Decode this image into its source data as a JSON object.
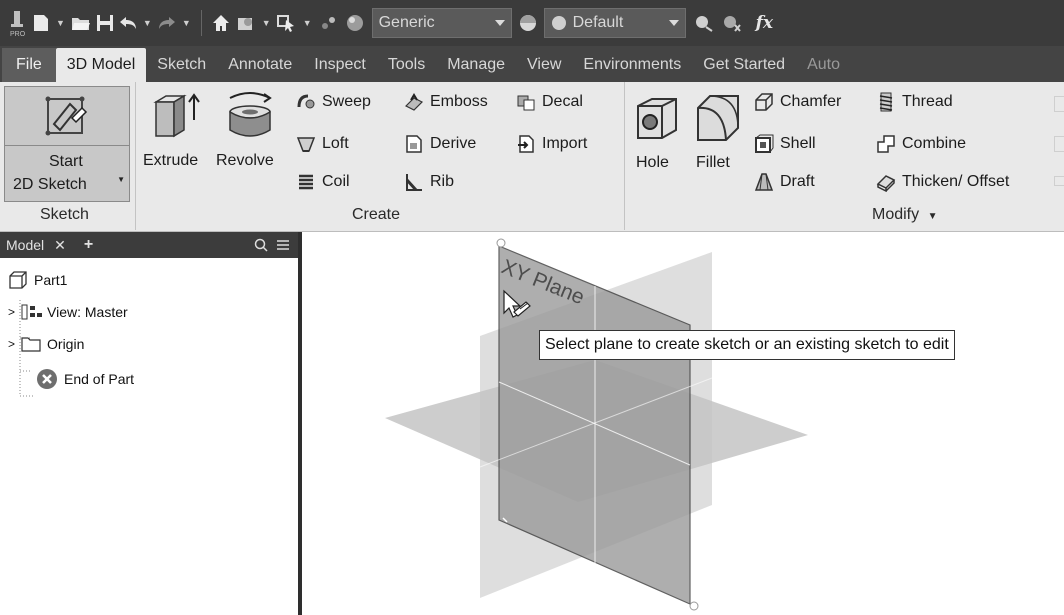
{
  "qat": {
    "material": "Generic",
    "appearance": "Default",
    "function_symbol": "fx",
    "icons": [
      "inventor-pro-logo",
      "new-icon",
      "open-icon",
      "save-icon",
      "undo-icon",
      "redo-icon",
      "home-icon",
      "update-icon",
      "select-icon",
      "color-icon",
      "material-ball-icon",
      "appearance-ball-icon",
      "clear-override-icon",
      "adjust-icon",
      "parameters-icon"
    ]
  },
  "tabs": [
    {
      "label": "File"
    },
    {
      "label": "3D Model",
      "active": true
    },
    {
      "label": "Sketch"
    },
    {
      "label": "Annotate"
    },
    {
      "label": "Inspect"
    },
    {
      "label": "Tools"
    },
    {
      "label": "Manage"
    },
    {
      "label": "View"
    },
    {
      "label": "Environments"
    },
    {
      "label": "Get Started"
    },
    {
      "label": "Auto"
    }
  ],
  "ribbon": {
    "sketch_group": {
      "start_line1": "Start",
      "start_line2": "2D Sketch",
      "label": "Sketch"
    },
    "create_group": {
      "extrude": "Extrude",
      "revolve": "Revolve",
      "sweep": "Sweep",
      "loft": "Loft",
      "coil": "Coil",
      "emboss": "Emboss",
      "derive": "Derive",
      "rib": "Rib",
      "decal": "Decal",
      "import": "Import",
      "label": "Create"
    },
    "modify_group": {
      "hole": "Hole",
      "fillet": "Fillet",
      "chamfer": "Chamfer",
      "shell": "Shell",
      "draft": "Draft",
      "thread": "Thread",
      "combine": "Combine",
      "thicken": "Thicken/ Offset",
      "label": "Modify"
    }
  },
  "browser": {
    "tab_label": "Model",
    "tree": [
      {
        "label": "Part1"
      },
      {
        "label": "View: Master"
      },
      {
        "label": "Origin"
      },
      {
        "label": "End of Part"
      }
    ]
  },
  "viewport": {
    "plane_label": "XY Plane",
    "tooltip": "Select plane to create sketch or an existing sketch to edit"
  }
}
